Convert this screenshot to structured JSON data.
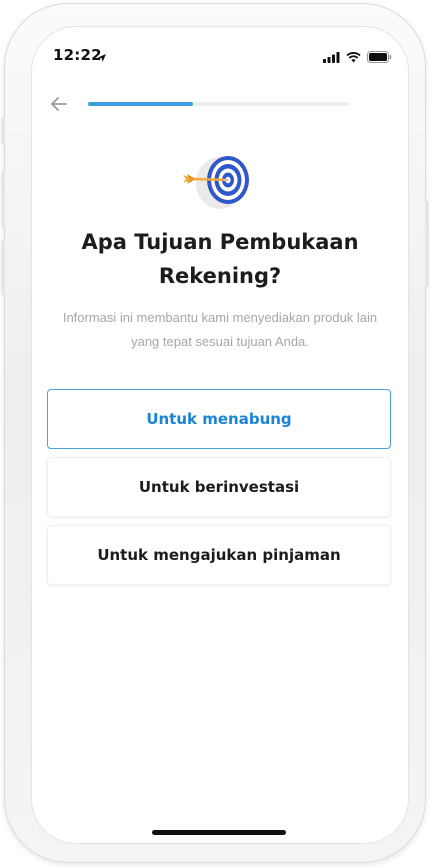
{
  "status_bar": {
    "time": "12:22",
    "icons": [
      "location-arrow-icon",
      "signal-icon",
      "wifi-icon",
      "battery-icon"
    ]
  },
  "nav": {
    "back_icon": "arrow-left-icon",
    "progress": 0.4
  },
  "hero": {
    "icon": "dart-target-icon"
  },
  "content": {
    "title": "Apa Tujuan Pembukaan Rekening?",
    "subtitle": "Informasi ini membantu kami menyediakan produk lain yang tepat sesuai tujuan Anda."
  },
  "options": [
    {
      "label": "Untuk menabung",
      "selected": true
    },
    {
      "label": "Untuk berinvestasi",
      "selected": false
    },
    {
      "label": "Untuk mengajukan pinjaman",
      "selected": false
    }
  ],
  "colors": {
    "accent": "#1a84d6",
    "progress": "#3aa0e0",
    "title": "#1c1c1c",
    "subtitle": "#a6a6a6"
  }
}
